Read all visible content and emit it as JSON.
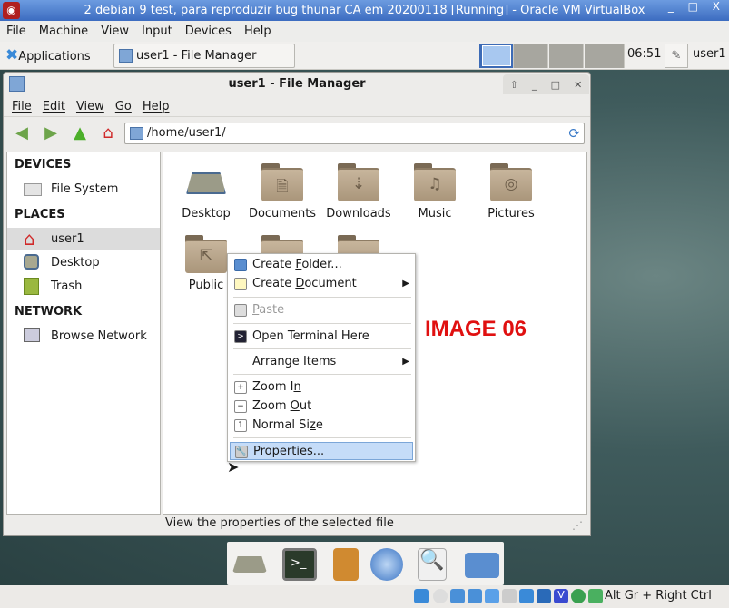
{
  "vbox": {
    "title": "2 debian 9 test, para reproduzir bug thunar CA em 20200118 [Running] - Oracle VM VirtualBox",
    "controls": "_ □ X",
    "menu": [
      "File",
      "Machine",
      "View",
      "Input",
      "Devices",
      "Help"
    ],
    "host_key": "Alt Gr + Right Ctrl"
  },
  "panel": {
    "applications": "Applications",
    "task": "user1 - File Manager",
    "clock": "06:51",
    "user": "user1"
  },
  "window": {
    "title": "user1 - File Manager",
    "menu": [
      "File",
      "Edit",
      "View",
      "Go",
      "Help"
    ],
    "address": "/home/user1/",
    "sidebar": {
      "devices_header": "DEVICES",
      "devices": [
        "File System"
      ],
      "places_header": "PLACES",
      "places": [
        "user1",
        "Desktop",
        "Trash"
      ],
      "network_header": "NETWORK",
      "network": [
        "Browse Network"
      ]
    },
    "files": [
      "Desktop",
      "Documents",
      "Downloads",
      "Music",
      "Pictures",
      "Public"
    ],
    "status": "View the properties of the selected file"
  },
  "context_menu": [
    {
      "label": "Create Folder...",
      "mn": "F"
    },
    {
      "label": "Create Document",
      "mn": "D",
      "submenu": true
    },
    {
      "label": "Paste",
      "mn": "P",
      "disabled": true
    },
    {
      "label": "Open Terminal Here"
    },
    {
      "label": "Arrange Items",
      "submenu": true
    },
    {
      "label": "Zoom In",
      "mn": "n"
    },
    {
      "label": "Zoom Out",
      "mn": "O"
    },
    {
      "label": "Normal Size",
      "mn": "z"
    },
    {
      "label": "Properties...",
      "mn": "P",
      "selected": true
    }
  ],
  "annotation": "IMAGE 06",
  "colors": {
    "titlebar": "#3c6cc0",
    "selection": "#c5dcf8",
    "annotation": "#e01010",
    "folder": "#b7a58b"
  }
}
